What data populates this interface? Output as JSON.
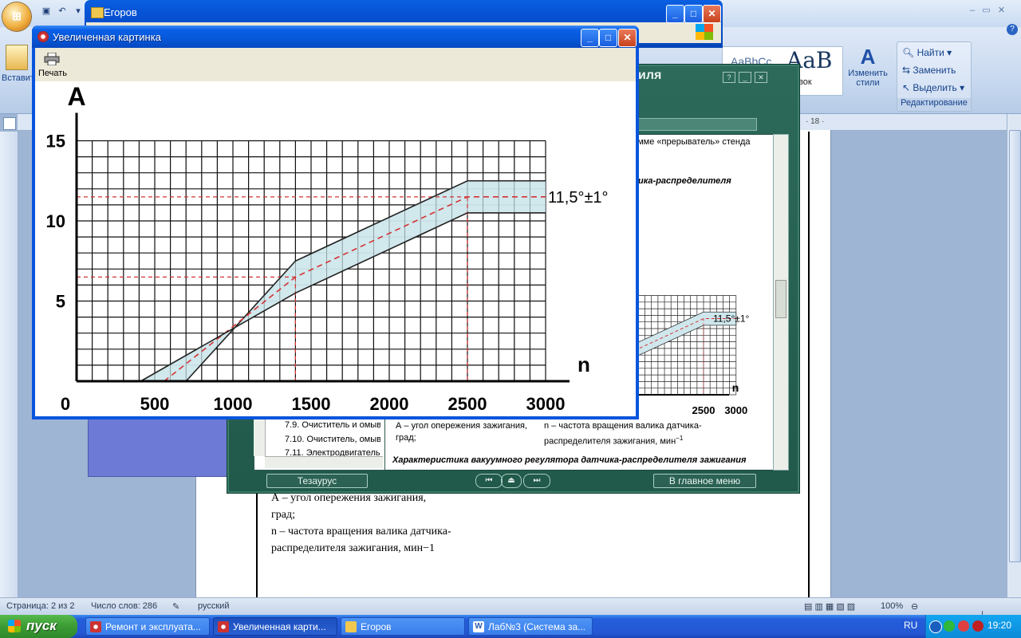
{
  "word": {
    "insert_label": "Вставить",
    "styles": {
      "sample_top": "AaB",
      "sample_small": "AaBbCc",
      "sample_label": "Заголовок"
    },
    "change_styles_label": "Изменить стили",
    "edit_group": {
      "find": "Найти",
      "replace": "Заменить",
      "select": "Выделить",
      "caption": "Редактирование"
    },
    "ruler_value": "· 18 ·",
    "page_text": [
      "А – угол опережения зажигания,",
      "град;",
      "n – частота вращения валика датчика-",
      "распределителя зажигания, мин−1"
    ],
    "status": {
      "page": "Страница: 2 из 2",
      "words": "Число слов: 286",
      "lang": "русский",
      "zoom": "100%"
    }
  },
  "explorer": {
    "title": "Егоров"
  },
  "green_app": {
    "title_fragment": "иля",
    "text_top": "емме «прерыватель» стенда",
    "text_italic": "ика-распределителя",
    "list_items": [
      "7.9. Очиститель и омыва",
      "7.10. Очиститель, омыва",
      "7.11. Электродвигатель"
    ],
    "label_a": "А – угол опережения зажигания, град;",
    "label_n": "n – частота вращения валика датчика-распределителя зажигания, мин",
    "label_n_sup": "−1",
    "caption": "Характеристика вакуумного регулятора датчика-распределителя зажигания",
    "nav_thesaurus": "Тезаурус",
    "nav_main": "В главное меню",
    "mini_x_ticks": [
      "2500",
      "3000"
    ],
    "mini_n": "n",
    "mini_annotation": "11,5°±1°"
  },
  "pic_window": {
    "title": "Увеличенная картинка",
    "print_label": "Печать"
  },
  "taskbar": {
    "start": "пуск",
    "tasks": [
      "Ремонт и эксплуата...",
      "Увеличенная карти...",
      "Егоров",
      "Лаб№3 (Система за..."
    ],
    "lang": "RU",
    "time": "19:20"
  },
  "chart_data": {
    "type": "line",
    "xlabel": "n",
    "ylabel": "А",
    "x_ticks": [
      "0",
      "500",
      "1000",
      "1500",
      "2000",
      "2500",
      "3000"
    ],
    "y_ticks": [
      "5",
      "10",
      "15"
    ],
    "xlim": [
      0,
      3000
    ],
    "ylim": [
      0,
      15
    ],
    "grid": true,
    "annotation": "11,5°±1°",
    "series": [
      {
        "role": "upper-bound",
        "color": "#222222",
        "x": [
          700,
          1400,
          2500,
          3000
        ],
        "y": [
          0,
          7.5,
          12.5,
          12.5
        ]
      },
      {
        "role": "nominal",
        "color": "#d33333",
        "dashed": true,
        "x": [
          560,
          1400,
          2500,
          3000
        ],
        "y": [
          0,
          6.5,
          11.5,
          11.5
        ]
      },
      {
        "role": "lower-bound",
        "color": "#222222",
        "x": [
          410,
          1400,
          2500,
          3000
        ],
        "y": [
          0,
          5.5,
          10.5,
          10.5
        ]
      }
    ],
    "band_color": "#cfe7ec",
    "reference_lines": [
      {
        "x": 1400,
        "y": 6.5
      },
      {
        "x": 2500,
        "y": 11.5
      }
    ]
  }
}
